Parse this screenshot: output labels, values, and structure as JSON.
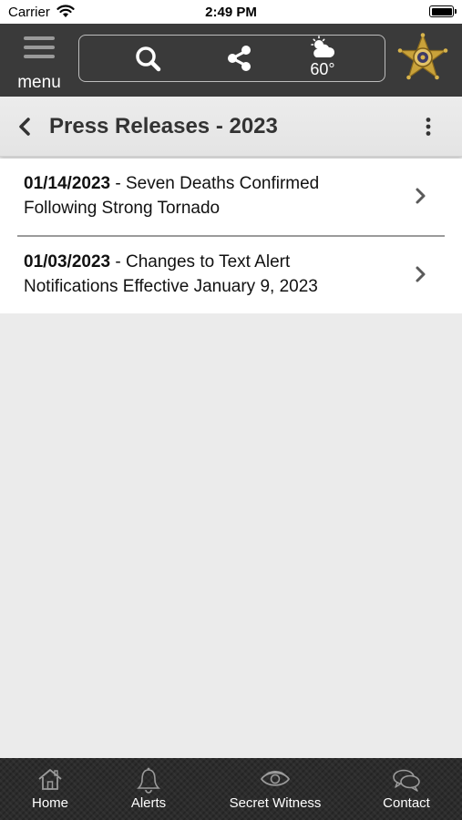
{
  "status_bar": {
    "carrier": "Carrier",
    "time": "2:49 PM",
    "battery_level": 1.0
  },
  "app_bar": {
    "menu_label": "menu",
    "weather_temp": "60°",
    "icons": [
      "hamburger-icon",
      "search-icon",
      "share-icon",
      "partly-cloudy-icon",
      "sheriff-star-badge"
    ]
  },
  "page": {
    "title": "Press Releases - 2023"
  },
  "releases": [
    {
      "date": "01/14/2023",
      "title": " - Seven Deaths Confirmed Following Strong Tornado"
    },
    {
      "date": "01/03/2023",
      "title": " - Changes to Text Alert Notifications Effective January 9, 2023"
    }
  ],
  "tabs": [
    {
      "label": "Home",
      "icon": "home-icon"
    },
    {
      "label": "Alerts",
      "icon": "bell-icon"
    },
    {
      "label": "Secret Witness",
      "icon": "eye-icon"
    },
    {
      "label": "Contact",
      "icon": "chat-bubbles-icon"
    }
  ],
  "colors": {
    "app_bar": "#3a3a3a",
    "header_bg": "#e8e8e8",
    "page_bg": "#ebebeb",
    "list_bg": "#ffffff",
    "tab_bar": "#2c2c2c",
    "badge_gold": "#c9a23a"
  }
}
